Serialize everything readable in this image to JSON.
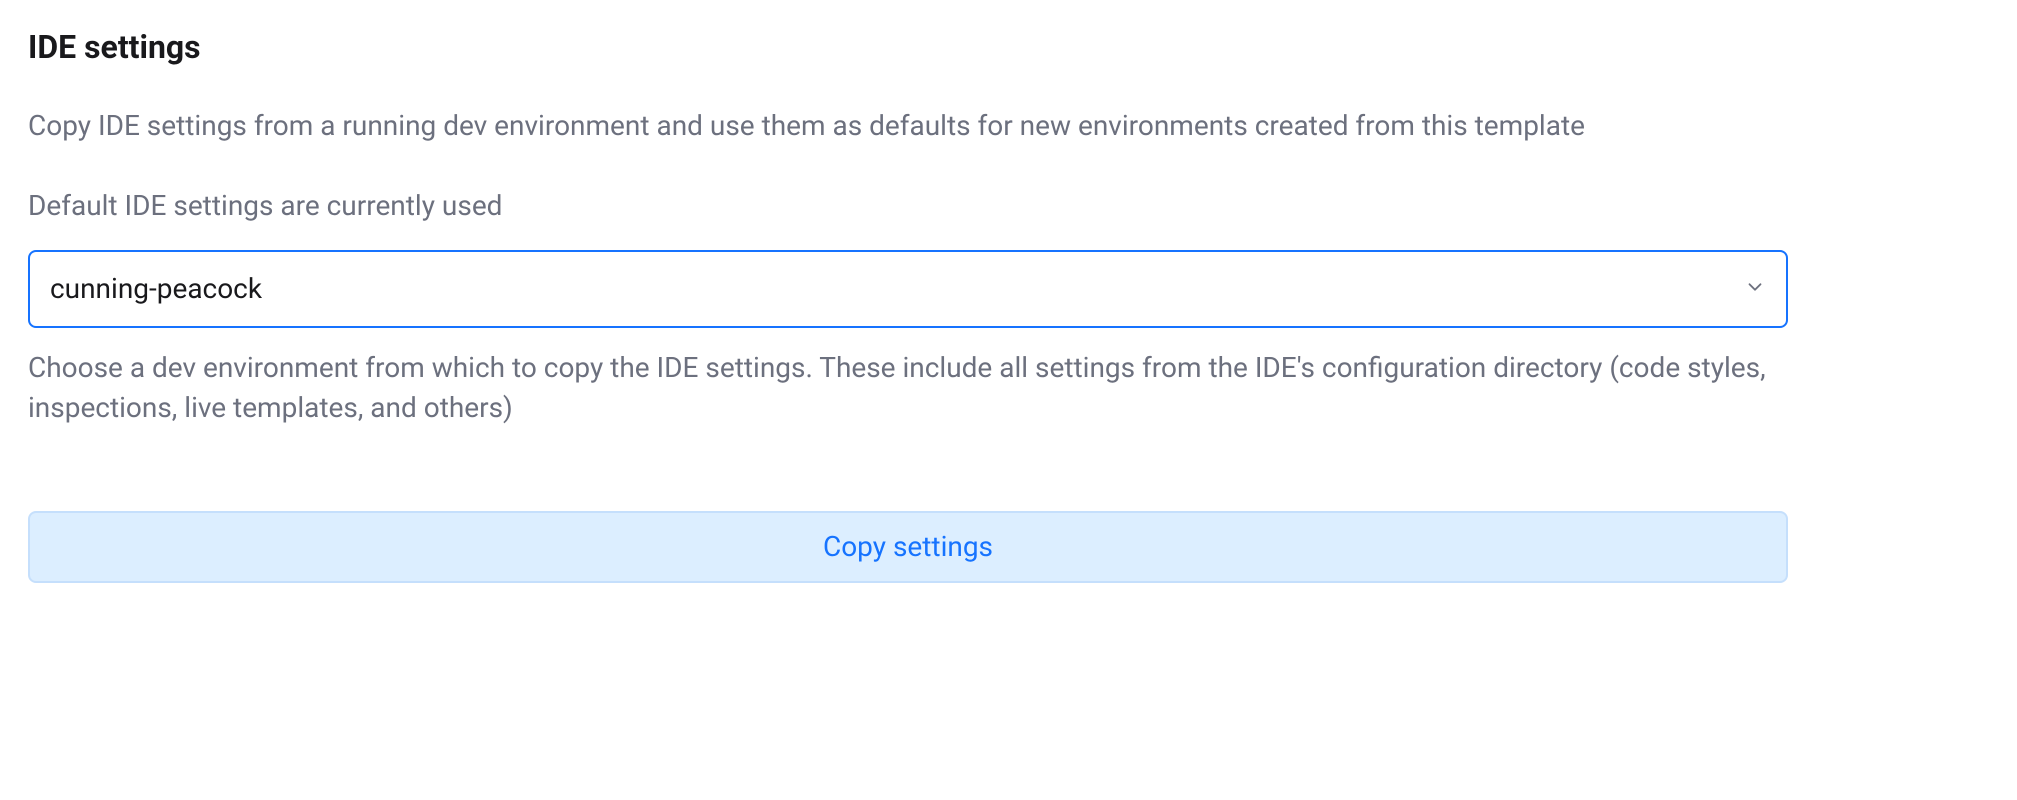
{
  "section": {
    "title": "IDE settings",
    "description": "Copy IDE settings from a running dev environment and use them as defaults for new environments created from this template",
    "status": "Default IDE settings are currently used",
    "dropdown_value": "cunning-peacock",
    "help_text": "Choose a dev environment from which to copy the IDE settings. These include all settings from the IDE's configuration directory (code styles, inspections, live templates, and others)",
    "copy_button_label": "Copy settings"
  }
}
